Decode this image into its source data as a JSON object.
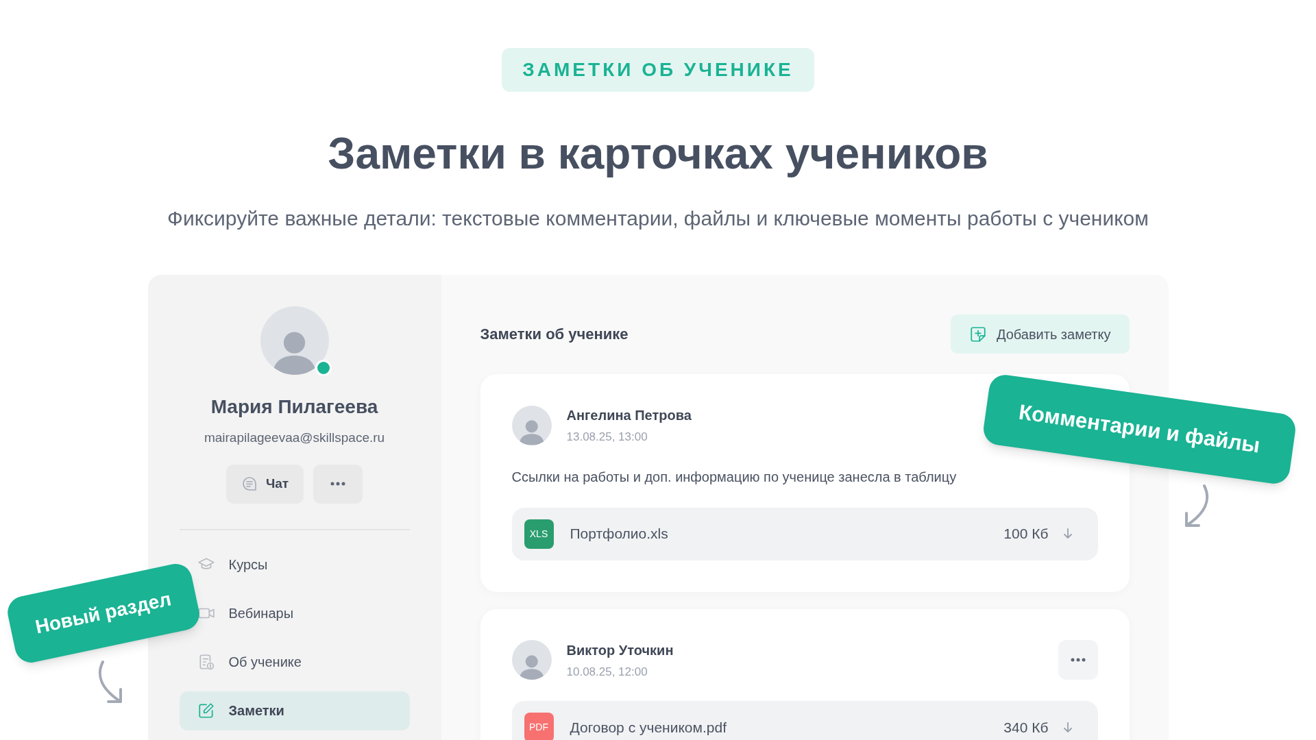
{
  "badge": "ЗАМЕТКИ ОБ УЧЕНИКЕ",
  "title": "Заметки в карточках учеников",
  "subtitle": "Фиксируйте важные детали: текстовые комментарии, файлы и ключевые моменты работы с учеником",
  "profile": {
    "name": "Мария Пилагеева",
    "email": "mairapilageevaa@skillspace.ru",
    "online": true,
    "chat_button": "Чат"
  },
  "nav": [
    {
      "label": "Курсы",
      "selected": false
    },
    {
      "label": "Вебинары",
      "selected": false
    },
    {
      "label": "Об ученике",
      "selected": false
    },
    {
      "label": "Заметки",
      "selected": true
    }
  ],
  "notes_heading": "Заметки об ученике",
  "add_button": "Добавить заметку",
  "notes": [
    {
      "author": "Ангелина Петрова",
      "date": "13.08.25, 13:00",
      "menu": false,
      "text": "Ссылки на работы и доп. информацию по ученице занесла в таблицу",
      "file": {
        "type": "XLS",
        "color": "#2a9d6f",
        "name": "Портфолио.xls",
        "size": "100 Кб"
      }
    },
    {
      "author": "Виктор Уточкин",
      "date": "10.08.25, 12:00",
      "menu": true,
      "file": {
        "type": "PDF",
        "color": "#f87171",
        "name": "Договор с учеником.pdf",
        "size": "340 Кб"
      }
    }
  ],
  "stickers": [
    {
      "kind": "right",
      "text": "Комментарии и файлы"
    },
    {
      "kind": "left",
      "text": "Новый раздел"
    }
  ]
}
